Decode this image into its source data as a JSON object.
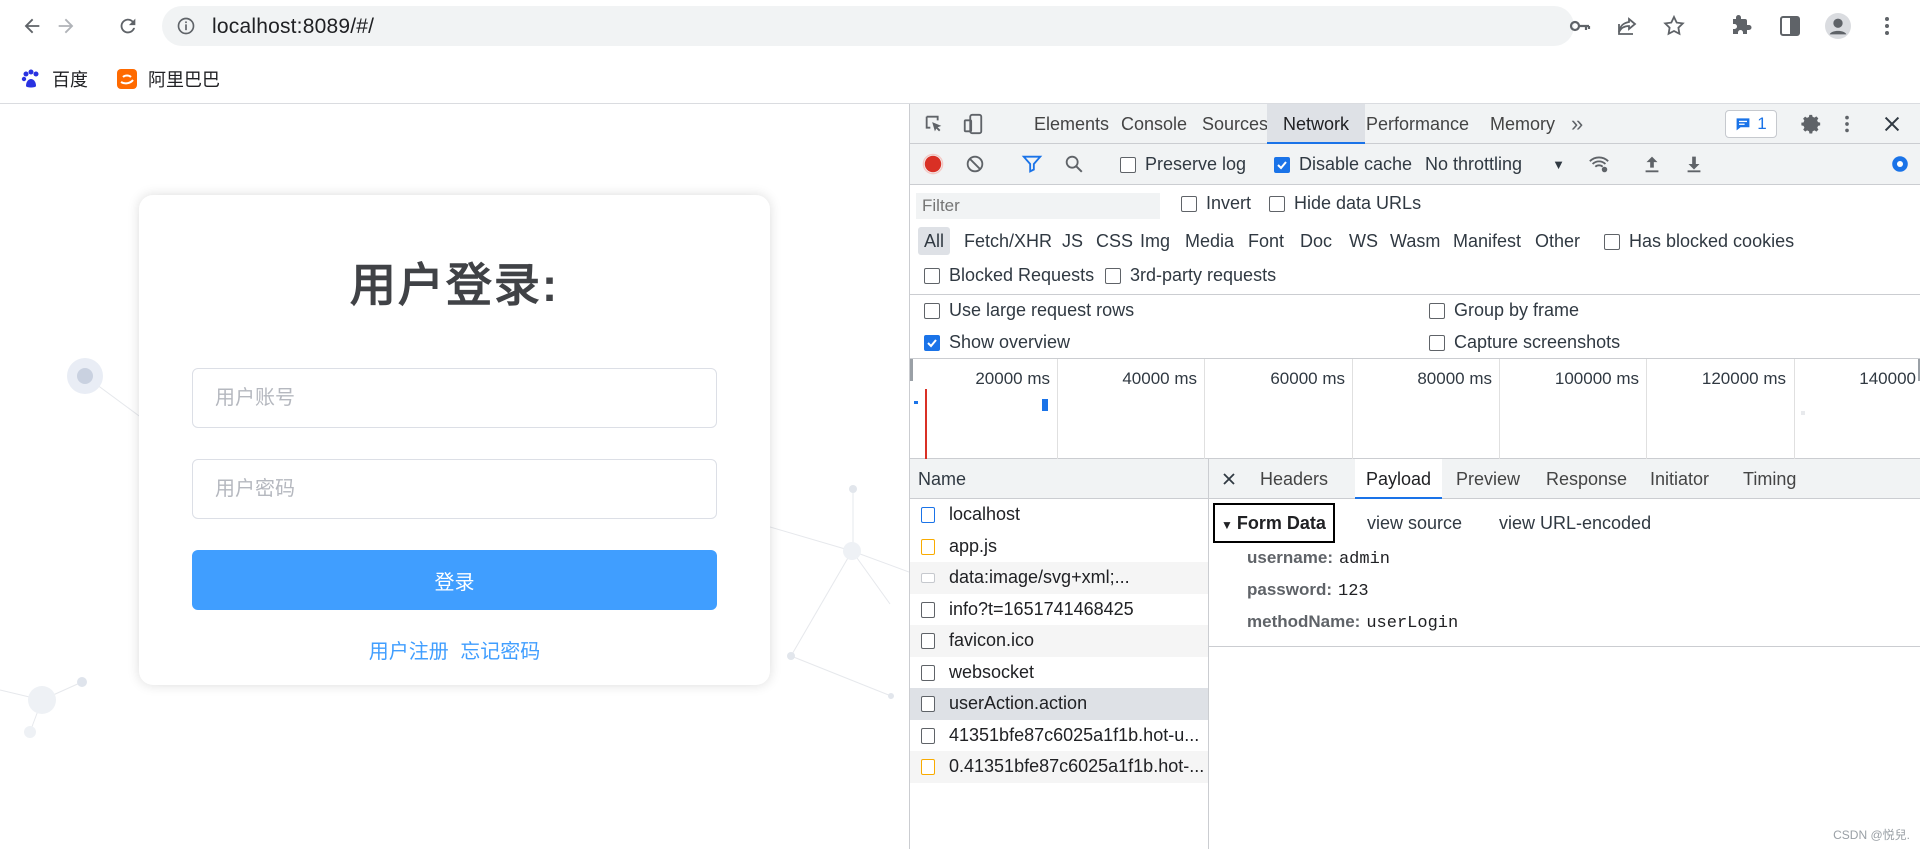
{
  "browser": {
    "url": "localhost:8089/#/",
    "bookmarks": [
      {
        "label": "百度",
        "icon": "baidu-paw-icon"
      },
      {
        "label": "阿里巴巴",
        "icon": "alibaba-icon"
      }
    ]
  },
  "login": {
    "title": "用户登录:",
    "username_placeholder": "用户账号",
    "password_placeholder": "用户密码",
    "login_button": "登录",
    "register_link": "用户注册",
    "forgot_link": "忘记密码"
  },
  "devtools": {
    "tabs": [
      "Elements",
      "Console",
      "Sources",
      "Network",
      "Performance",
      "Memory"
    ],
    "active_tab": "Network",
    "more_tabs": "»",
    "issues_count": "1",
    "toolbar": {
      "preserve_log": "Preserve log",
      "disable_cache": "Disable cache",
      "throttling": "No throttling"
    },
    "filter": {
      "placeholder": "Filter",
      "invert": "Invert",
      "hide_data_urls": "Hide data URLs",
      "types": [
        "All",
        "Fetch/XHR",
        "JS",
        "CSS",
        "Img",
        "Media",
        "Font",
        "Doc",
        "WS",
        "Wasm",
        "Manifest",
        "Other"
      ],
      "has_blocked_cookies": "Has blocked cookies",
      "blocked_requests": "Blocked Requests",
      "third_party": "3rd-party requests"
    },
    "settings": {
      "large_rows": "Use large request rows",
      "group_by_frame": "Group by frame",
      "show_overview": "Show overview",
      "capture_screenshots": "Capture screenshots"
    },
    "overview_ticks": [
      "20000 ms",
      "40000 ms",
      "60000 ms",
      "80000 ms",
      "100000 ms",
      "120000 ms",
      "140000"
    ],
    "requests_header": "Name",
    "requests": [
      {
        "name": "localhost",
        "type": "doc"
      },
      {
        "name": "app.js",
        "type": "js"
      },
      {
        "name": "data:image/svg+xml;...",
        "type": "img"
      },
      {
        "name": "info?t=1651741468425",
        "type": "other"
      },
      {
        "name": "favicon.ico",
        "type": "other"
      },
      {
        "name": "websocket",
        "type": "other"
      },
      {
        "name": "userAction.action",
        "type": "other"
      },
      {
        "name": "41351bfe87c6025a1f1b.hot-u...",
        "type": "other"
      },
      {
        "name": "0.41351bfe87c6025a1f1b.hot-...",
        "type": "js"
      }
    ],
    "detail_tabs": [
      "Headers",
      "Payload",
      "Preview",
      "Response",
      "Initiator",
      "Timing"
    ],
    "active_detail_tab": "Payload",
    "form_data": {
      "title": "Form Data",
      "view_source": "view source",
      "view_url_encoded": "view URL-encoded",
      "fields": [
        {
          "key": "username:",
          "value": "admin"
        },
        {
          "key": "password:",
          "value": "123"
        },
        {
          "key": "methodName:",
          "value": "userLogin"
        }
      ]
    }
  },
  "watermark": "CSDN @悦兒."
}
